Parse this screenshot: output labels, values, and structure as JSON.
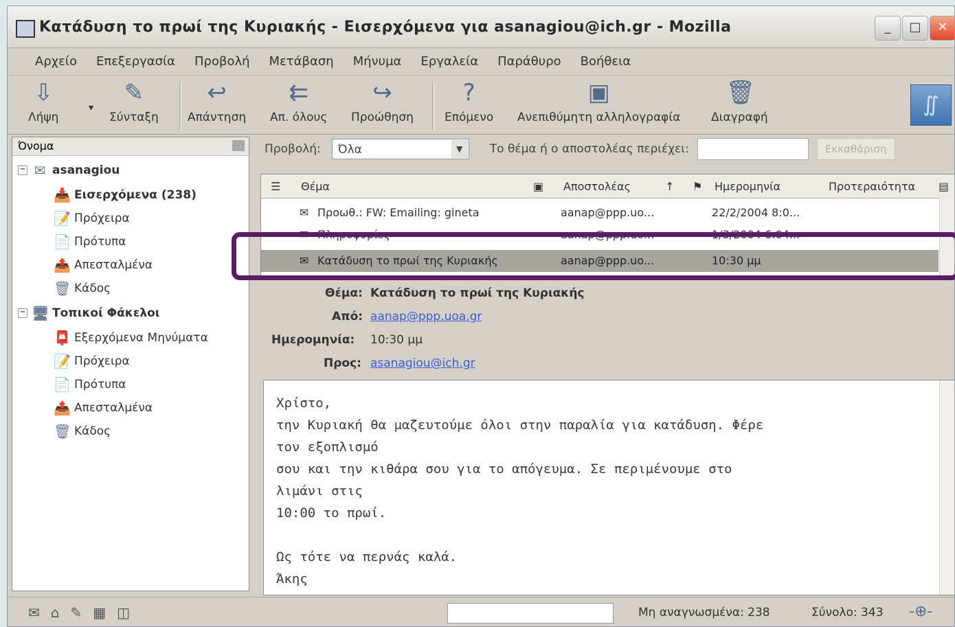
{
  "window": {
    "title": "Κατάδυση το πρωί της Κυριακής - Εισερχόμενα για asanagiou@ich.gr - Mozilla"
  },
  "menu": [
    "Αρχείο",
    "Επεξεργασία",
    "Προβολή",
    "Μετάβαση",
    "Μήνυμα",
    "Εργαλεία",
    "Παράθυρο",
    "Βοήθεια"
  ],
  "toolbar": {
    "get": "Λήψη",
    "compose": "Σύνταξη",
    "reply": "Απάντηση",
    "reply_all": "Απ. όλους",
    "forward": "Προώθηση",
    "next": "Επόμενο",
    "junk": "Ανεπιθύμητη αλληλογραφία",
    "delete": "Διαγραφή"
  },
  "sidebar": {
    "header": "Όνομα",
    "account": "asanagiou",
    "folders": [
      "Εισερχόμενα (238)",
      "Πρόχειρα",
      "Πρότυπα",
      "Απεσταλμένα",
      "Κάδος"
    ],
    "local": "Τοπικοί Φάκελοι",
    "local_folders": [
      "Εξερχόμενα Μηνύματα",
      "Πρόχειρα",
      "Πρότυπα",
      "Απεσταλμένα",
      "Κάδος"
    ]
  },
  "filter": {
    "view_label": "Προβολή:",
    "view_value": "Όλα",
    "search_label": "Το θέμα ή ο αποστολέας περιέχει:",
    "clear": "Εκκαθάριση"
  },
  "columns": {
    "subject": "Θέμα",
    "sender": "Αποστολέας",
    "date": "Ημερομηνία",
    "priority": "Προτεραιότητα"
  },
  "messages": [
    {
      "subject": "Προωθ.: FW: Emailing: gineta",
      "sender": "aanap@ppp.uo...",
      "date": "22/2/2004 8:0..."
    },
    {
      "subject": "Πληροφορίες",
      "sender": "aanap@ppp.uo...",
      "date": "1/3/2004 6:04..."
    },
    {
      "subject": "Κατάδυση το πρωί της Κυριακής",
      "sender": "aanap@ppp.uo...",
      "date": "10:30 μμ"
    }
  ],
  "header": {
    "subject_key": "Θέμα:",
    "subject": "Κατάδυση το πρωί της Κυριακής",
    "from_key": "Από:",
    "from": "aanap@ppp.uoa.gr",
    "date_key": "Ημερομηνία:",
    "date": "10:30 μμ",
    "to_key": "Προς:",
    "to": "asanagiou@ich.gr"
  },
  "body": [
    "Χρίστο,",
    "την Κυριακή θα μαζευτούμε όλοι στην παραλία για κατάδυση. Φέρε",
    "τον εξοπλισμό",
    "σου και την κιθάρα σου για το απόγευμα.  Σε περιμένουμε στο",
    "λιμάνι στις",
    "10:00 το πρωί.",
    "",
    "Ως τότε να περνάς καλά.",
    "Άκης"
  ],
  "status": {
    "unread": "Μη αναγνωσμένα: 238",
    "total": "Σύνολο: 343"
  },
  "accent_color": "#5c1b66"
}
